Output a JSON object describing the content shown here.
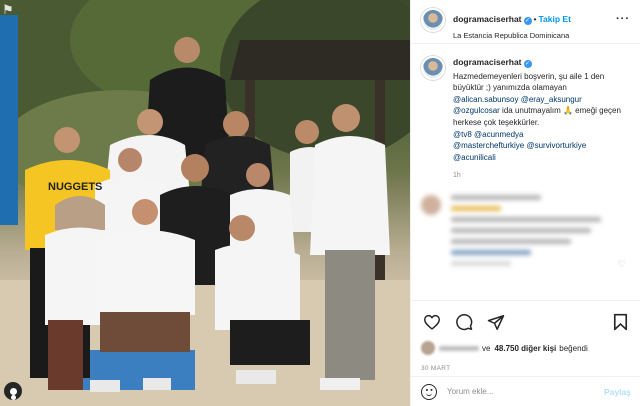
{
  "post": {
    "username": "dogramaciserhat",
    "follow_label": "Takip Et",
    "separator": "•",
    "location": "La Estancia Republica Dominicana",
    "more_icon": "ellipsis-icon",
    "photo_alt": "Group photo of chefs on a beach"
  },
  "caption": {
    "username": "dogramaciserhat",
    "text": "Hazmedemeyenleri boşverin, şu aile 1 den büyüktür ;) yanımızda olamayan",
    "mentions_1": [
      "@alican.sabunsoy",
      "@eray_aksungur"
    ],
    "mentions_2": "@ozgulcosar",
    "text_2": "ida unutmayalım 🙏 emeği geçen herkese çok teşekkürler.",
    "tags": [
      "@tv8 @acunmedya",
      "@masterchefturkiye @survivorturkiye",
      "@acunilicali"
    ],
    "time_ago": "1h"
  },
  "actions": {
    "icons": [
      "heart-icon",
      "comment-icon",
      "share-icon",
      "bookmark-icon"
    ],
    "likes_prefix_blurred": "maparilly",
    "likes_count_text": "48.750 diğer kişi",
    "likes_suffix": "beğendi",
    "date": "30 MART"
  },
  "comment_box": {
    "placeholder": "Yorum ekle...",
    "post_label": "Paylaş"
  },
  "colors": {
    "accent": "#0095f6",
    "link": "#00376b",
    "muted": "#8e8e8e",
    "border": "#efefef"
  }
}
